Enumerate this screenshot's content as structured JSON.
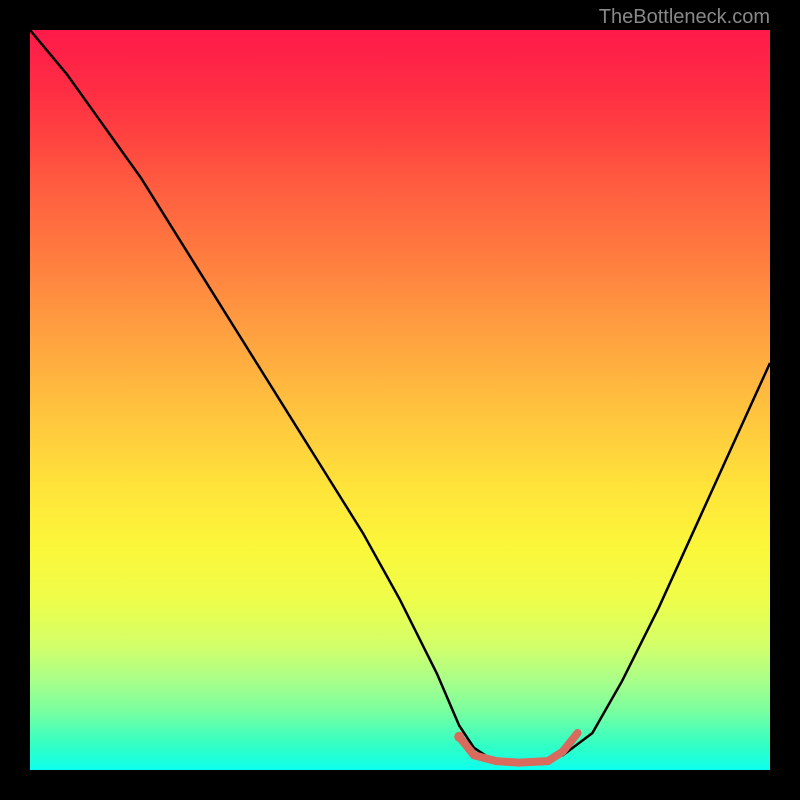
{
  "watermark": "TheBottleneck.com",
  "chart_data": {
    "type": "line",
    "title": "",
    "xlabel": "",
    "ylabel": "",
    "xlim": [
      0,
      100
    ],
    "ylim": [
      0,
      100
    ],
    "series": [
      {
        "name": "bottleneck-curve",
        "x": [
          0,
          5,
          10,
          15,
          20,
          25,
          30,
          35,
          40,
          45,
          50,
          55,
          58,
          60,
          63,
          68,
          72,
          76,
          80,
          85,
          90,
          95,
          100
        ],
        "values": [
          100,
          94,
          87,
          80,
          72,
          64,
          56,
          48,
          40,
          32,
          23,
          13,
          6,
          3,
          1,
          1,
          2,
          5,
          12,
          22,
          33,
          44,
          55
        ]
      }
    ],
    "marker_segment": {
      "name": "optimal-range",
      "color": "#d86a5e",
      "x": [
        58,
        60,
        63,
        66,
        70,
        72,
        74
      ],
      "values": [
        4.5,
        2.0,
        1.2,
        1.0,
        1.2,
        2.5,
        5.0
      ]
    }
  }
}
